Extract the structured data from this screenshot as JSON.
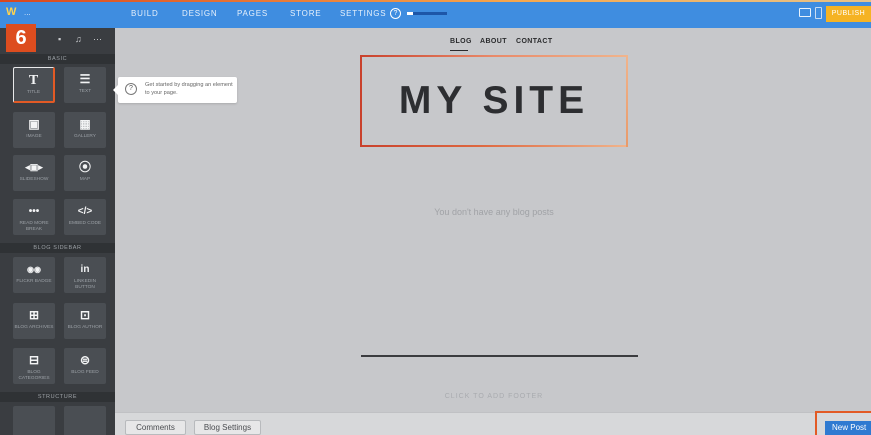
{
  "topbar": {
    "brand_label": "...",
    "nav": [
      "BUILD",
      "DESIGN",
      "PAGES",
      "STORE",
      "SETTINGS"
    ],
    "help_symbol": "?",
    "progress_fraction": 0.15,
    "publish_label": "PUBLISH",
    "accent_color": "#3f8de0",
    "publish_color": "#f5b324"
  },
  "sidebar": {
    "step_number": "6",
    "top_icons": [
      "image-icon",
      "music-icon",
      "more-icon"
    ],
    "top_icon_glyphs": [
      "▪",
      "♫",
      "⋯"
    ],
    "sections": {
      "basic": "BASIC",
      "blog_sidebar": "BLOG SIDEBAR",
      "structure": "STRUCTURE"
    },
    "tiles": [
      {
        "glyph": "T",
        "label": "TITLE",
        "icon": "title-icon"
      },
      {
        "glyph": "☰",
        "label": "TEXT",
        "icon": "text-icon"
      },
      {
        "glyph": "▣",
        "label": "IMAGE",
        "icon": "image-icon"
      },
      {
        "glyph": "▦",
        "label": "GALLERY",
        "icon": "gallery-icon"
      },
      {
        "glyph": "◂▣▸",
        "label": "SLIDESHOW",
        "icon": "slideshow-icon"
      },
      {
        "glyph": "⦿",
        "label": "MAP",
        "icon": "map-icon"
      },
      {
        "glyph": "•••",
        "label": "READ MORE BREAK",
        "icon": "read-more-icon"
      },
      {
        "glyph": "</>",
        "label": "EMBED CODE",
        "icon": "embed-code-icon"
      },
      {
        "glyph": "◉◉",
        "label": "FLICKR BADGE",
        "icon": "flickr-icon"
      },
      {
        "glyph": "in",
        "label": "LINKEDIN BUTTON",
        "icon": "linkedin-icon"
      },
      {
        "glyph": "⊞",
        "label": "BLOG ARCHIVES",
        "icon": "blog-archives-icon"
      },
      {
        "glyph": "⊡",
        "label": "BLOG AUTHOR",
        "icon": "blog-author-icon"
      },
      {
        "glyph": "⊟",
        "label": "BLOG CATEGORIES",
        "icon": "blog-categories-icon"
      },
      {
        "glyph": "⊜",
        "label": "BLOG FEED",
        "icon": "blog-feed-icon"
      }
    ]
  },
  "tooltip": {
    "symbol": "?",
    "text": "Get started by dragging an element to your page."
  },
  "canvas": {
    "menu": [
      "BLOG",
      "ABOUT",
      "CONTACT"
    ],
    "site_title": "MY SITE",
    "empty_message": "You don't have any blog posts",
    "footer_hint": "CLICK TO ADD FOOTER"
  },
  "bottombar": {
    "comments_label": "Comments",
    "settings_label": "Blog Settings",
    "new_post_label": "New Post"
  }
}
